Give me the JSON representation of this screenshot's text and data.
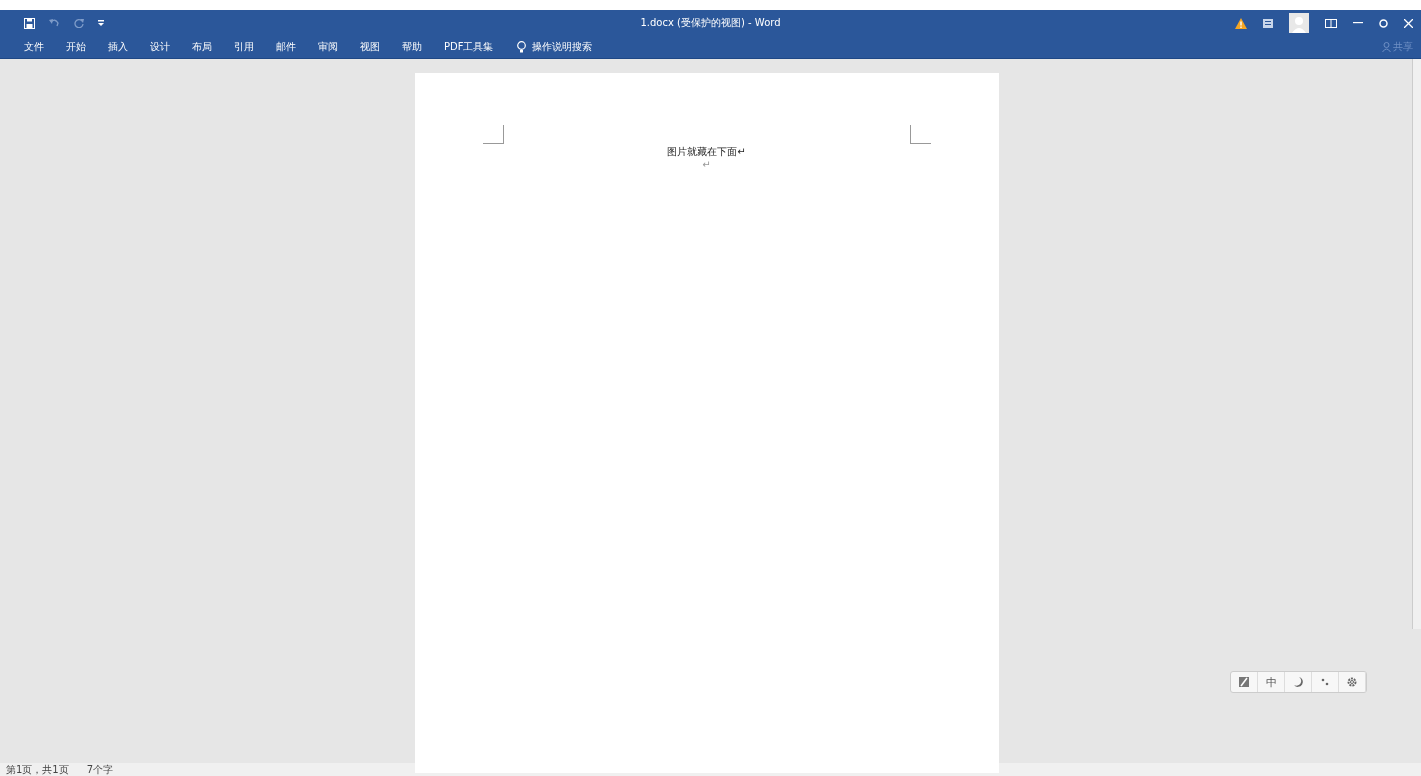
{
  "window": {
    "title": "1.docx (受保护的视图)  -  Word"
  },
  "ribbon_tabs": [
    {
      "label": "文件",
      "selected": false
    },
    {
      "label": "开始",
      "selected": false
    },
    {
      "label": "插入",
      "selected": false
    },
    {
      "label": "设计",
      "selected": false
    },
    {
      "label": "布局",
      "selected": false
    },
    {
      "label": "引用",
      "selected": false
    },
    {
      "label": "邮件",
      "selected": false
    },
    {
      "label": "审阅",
      "selected": false
    },
    {
      "label": "视图",
      "selected": false
    },
    {
      "label": "帮助",
      "selected": false
    },
    {
      "label": "PDF工具集",
      "selected": false
    }
  ],
  "tell_me": {
    "label": "操作说明搜索"
  },
  "share": {
    "label": "共享"
  },
  "document": {
    "paragraphs": [
      "图片就藏在下面↵",
      "↵"
    ]
  },
  "ime_toolbar": {
    "mode": "中"
  },
  "status_bar": [
    "第1页，共1页",
    "7个字"
  ]
}
